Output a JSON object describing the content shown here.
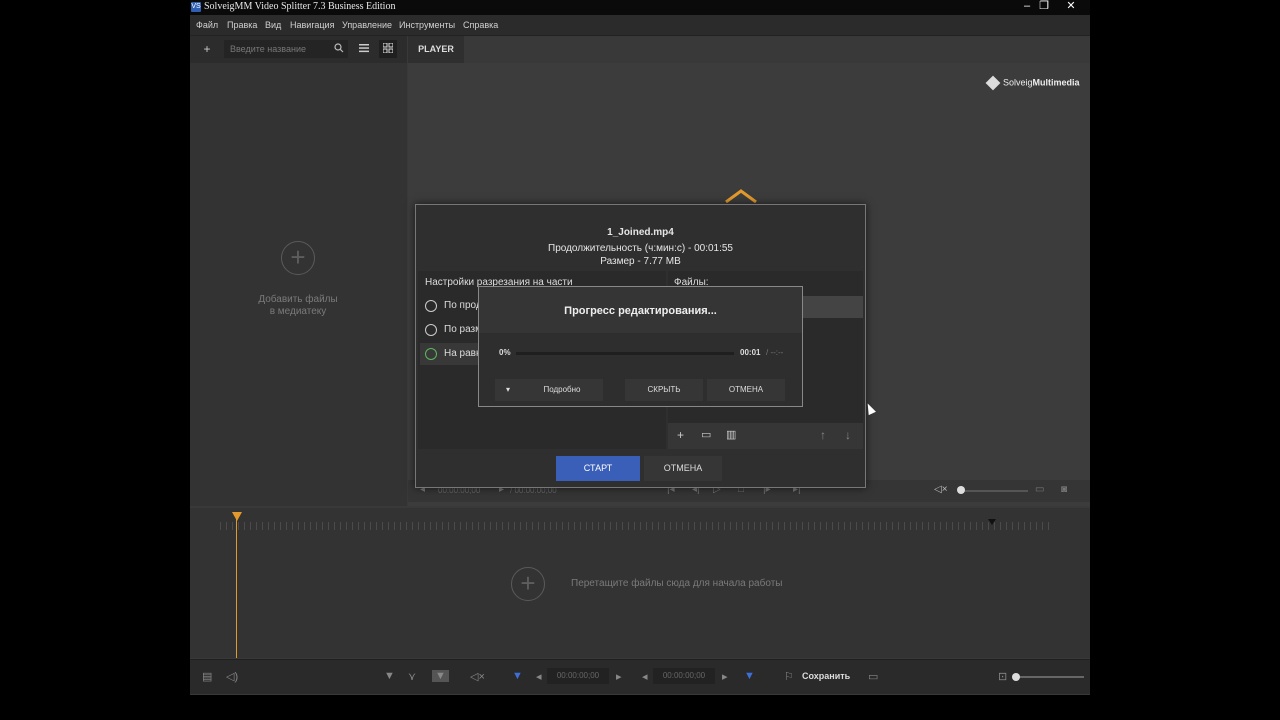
{
  "window": {
    "title": "SolveigMM Video Splitter 7.3 Business Edition",
    "minimize_glyph": "–",
    "maximize_glyph": "❐",
    "close_glyph": "✕"
  },
  "menu": {
    "items": [
      "Файл",
      "Правка",
      "Вид",
      "Навигация",
      "Управление",
      "Инструменты",
      "Справка"
    ]
  },
  "library": {
    "search_placeholder": "Введите название",
    "add_glyph": "+",
    "add_files_line1": "Добавить файлы",
    "add_files_line2": "в медиатеку"
  },
  "player": {
    "tab_label": "PLAYER",
    "logo_text_regular": "Solveig",
    "logo_text_bold": "Multimedia",
    "timecode_current": "00:00:00;00",
    "timecode_total": "/ 00:00:00;00"
  },
  "timeline": {
    "drop_hint": "Перетащите файлы сюда для начала работы"
  },
  "bottombar": {
    "timecode_in": "00:00:00;00",
    "timecode_out": "00:00:00;00",
    "save_label": "Сохранить"
  },
  "split_dialog": {
    "file_name": "1_Joined.mp4",
    "duration_line": "Продолжительность (ч:мин:с) - 00:01:55",
    "size_line": "Размер - 7.77 MB",
    "settings_header": "Настройки разрезания на части",
    "files_header": "Файлы:",
    "options": [
      "По продолжительности",
      "По размеру",
      "На равные части"
    ],
    "start_button": "СТАРТ",
    "cancel_button": "ОТМЕНА"
  },
  "progress_dialog": {
    "title": "Прогресс редактирования...",
    "percent_text": "0%",
    "progress_value": 0,
    "elapsed": "00:01",
    "remaining": "/ --:--",
    "details_button": "Подробно",
    "hide_button": "СКРЫТЬ",
    "cancel_button": "ОТМЕНА"
  },
  "colors": {
    "accent_blue": "#3a5fb8",
    "playhead_orange": "#e39a2d",
    "marker_blue": "#3c6fd8"
  }
}
